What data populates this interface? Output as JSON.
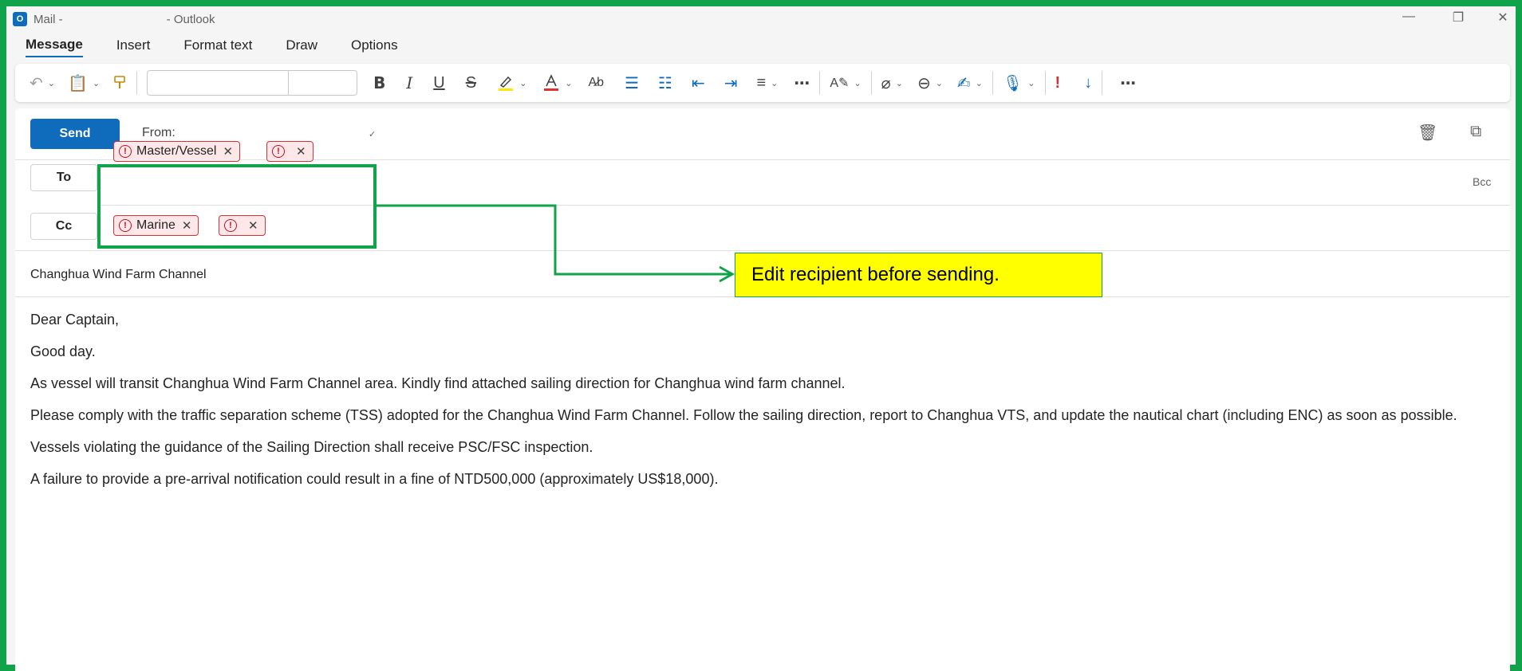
{
  "window": {
    "title_prefix": "Mail -",
    "title_app": "- Outlook",
    "app_icon": "outlook-icon",
    "controls": [
      "minimize-icon",
      "restore-icon",
      "close-icon"
    ]
  },
  "tabs": [
    {
      "label": "Message",
      "active": true
    },
    {
      "label": "Insert"
    },
    {
      "label": "Format text"
    },
    {
      "label": "Draw"
    },
    {
      "label": "Options"
    }
  ],
  "ribbon": {
    "font_name": "",
    "font_size": "",
    "icons": [
      "undo-icon",
      "paste-icon",
      "format-painter-icon",
      "bold-icon",
      "italic-icon",
      "underline-icon",
      "strikethrough-icon",
      "highlight-icon",
      "font-color-icon",
      "clear-format-icon",
      "bullets-icon",
      "numbering-icon",
      "decrease-indent-icon",
      "increase-indent-icon",
      "align-icon",
      "more-icon",
      "editor-icon",
      "attach-icon",
      "link-icon",
      "signature-icon",
      "dictate-icon",
      "high-importance-icon",
      "low-importance-icon",
      "more-options-icon"
    ]
  },
  "compose": {
    "send_label": "Send",
    "from_label": "From:",
    "to_label": "To",
    "cc_label": "Cc",
    "bcc_label": "Bcc",
    "to_recipients": [
      "Master/Vessel",
      ""
    ],
    "cc_recipients": [
      "Marine",
      ""
    ],
    "subject": "Changhua Wind Farm Channel",
    "body": [
      "Dear Captain,",
      "Good day.",
      "As vessel will transit Changhua Wind Farm Channel area. Kindly find attached sailing direction for Changhua wind farm channel.",
      "Please comply with the traffic separation scheme (TSS) adopted for the Changhua Wind Farm Channel. Follow the sailing direction, report to Changhua VTS, and update the nautical chart (including ENC) as soon as possible.",
      "Vessels violating the guidance of the Sailing Direction shall receive PSC/FSC inspection.",
      "A failure to provide a pre-arrival notification could result in a fine of NTD500,000 (approximately US$18,000)."
    ]
  },
  "annotation": {
    "text": "Edit recipient before sending.",
    "color_box": "#10a34a",
    "color_fill": "#ffff00"
  },
  "colors": {
    "frame": "#10a34a",
    "accent": "#0f6cbd",
    "error": "#d13438"
  }
}
